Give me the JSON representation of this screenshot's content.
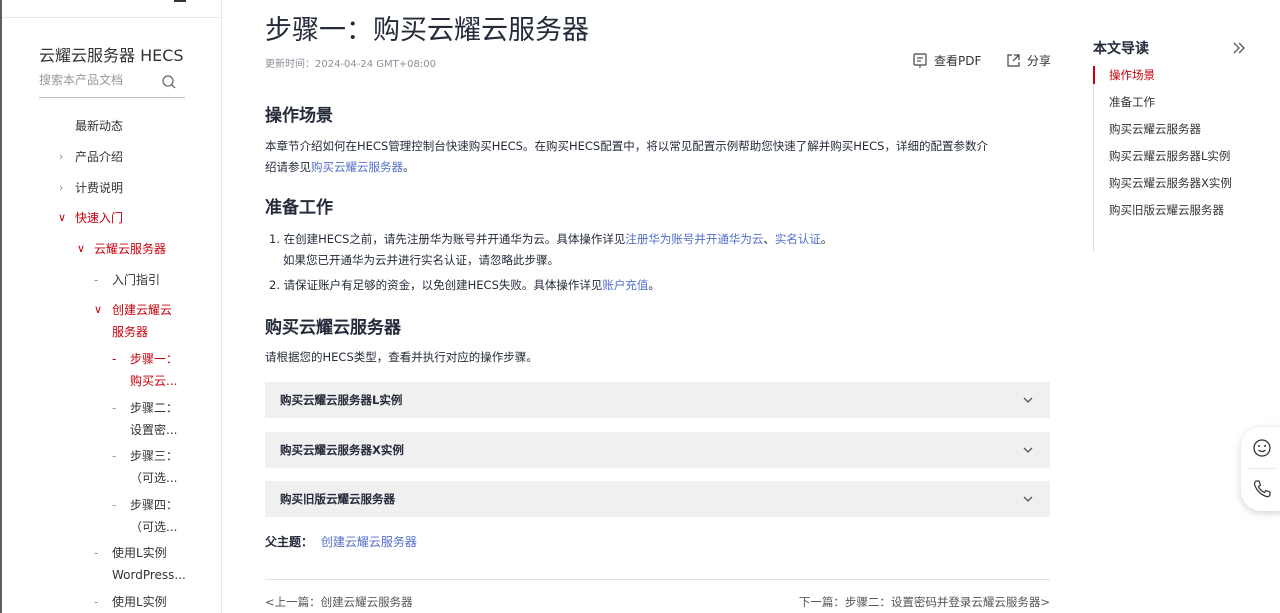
{
  "sidebar": {
    "product_title": "云耀云服务器 HECS",
    "search_placeholder": "搜索本产品文档",
    "items": [
      {
        "label": "最新动态"
      },
      {
        "label": "产品介绍"
      },
      {
        "label": "计费说明"
      },
      {
        "label": "快速入门"
      },
      {
        "label": "云耀云服务器"
      },
      {
        "label": "入门指引"
      },
      {
        "label": "创建云耀云",
        "label2": "服务器"
      },
      {
        "label": "步骤一：",
        "label2": "购买云..."
      },
      {
        "label": "步骤二：",
        "label2": "设置密..."
      },
      {
        "label": "步骤三：",
        "label2": "（可选..."
      },
      {
        "label": "步骤四：",
        "label2": "（可选..."
      },
      {
        "label": "使用L实例",
        "label2": "WordPress..."
      },
      {
        "label": "使用L实例"
      }
    ]
  },
  "main": {
    "title": "步骤一：购买云耀云服务器",
    "update_time": "更新时间：2024-04-24 GMT+08:00",
    "view_pdf": "查看PDF",
    "share": "分享",
    "sections": {
      "scenario_heading": "操作场景",
      "scenario_text1": "本章节介绍如何在HECS管理控制台快速购买HECS。在购买HECS配置中，将以常见配置示例帮助您快速了解并购买HECS，详细的配置参数介",
      "scenario_text2_prefix": "绍请参见",
      "scenario_link": "购买云耀云服务器",
      "scenario_text2_suffix": "。",
      "prep_heading": "准备工作",
      "prep_item1_prefix": "1. 在创建HECS之前，请先注册华为账号并开通华为云。具体操作详见",
      "prep_item1_link1": "注册华为账号并开通华为云",
      "prep_item1_sep": "、",
      "prep_item1_link2": "实名认证",
      "prep_item1_suffix": "。",
      "prep_item1_line2": "如果您已开通华为云并进行实名认证，请忽略此步骤。",
      "prep_item2_prefix": "2. 请保证账户有足够的资金，以免创建HECS失败。具体操作详见",
      "prep_item2_link": "账户充值",
      "prep_item2_suffix": "。",
      "buy_heading": "购买云耀云服务器",
      "buy_text": "请根据您的HECS类型，查看并执行对应的操作步骤。"
    },
    "accordions": [
      {
        "label": "购买云耀云服务器L实例"
      },
      {
        "label": "购买云耀云服务器X实例"
      },
      {
        "label": "购买旧版云耀云服务器"
      }
    ],
    "parent_topic_label": "父主题：",
    "parent_topic_link": "创建云耀云服务器",
    "prev": "<上一篇：创建云耀云服务器",
    "next": "下一篇：步骤二：设置密码并登录云耀云服务器>"
  },
  "toc": {
    "title": "本文导读",
    "items": [
      {
        "label": "操作场景"
      },
      {
        "label": "准备工作"
      },
      {
        "label": "购买云耀云服务器"
      },
      {
        "label": "购买云耀云服务器L实例"
      },
      {
        "label": "购买云耀云服务器X实例"
      },
      {
        "label": "购买旧版云耀云服务器"
      }
    ]
  },
  "colors": {
    "accent": "#c7000b",
    "link": "#526ecc"
  }
}
